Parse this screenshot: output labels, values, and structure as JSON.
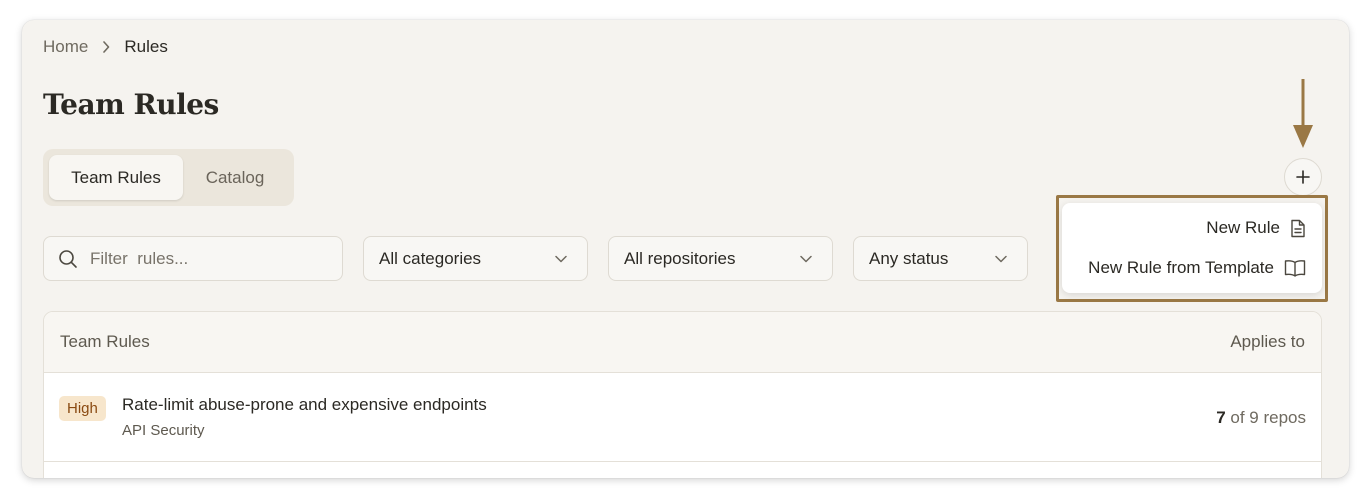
{
  "breadcrumb": {
    "home": "Home",
    "current": "Rules"
  },
  "page": {
    "title": "Team Rules"
  },
  "tabs": [
    {
      "label": "Team Rules",
      "active": true
    },
    {
      "label": "Catalog",
      "active": false
    }
  ],
  "filters": {
    "search_placeholder": "Filter  rules...",
    "category": "All categories",
    "repository": "All repositories",
    "status": "Any status"
  },
  "add_menu": {
    "items": [
      {
        "label": "New Rule",
        "icon": "document-icon"
      },
      {
        "label": "New Rule from Template",
        "icon": "book-icon"
      }
    ]
  },
  "table": {
    "header_left": "Team Rules",
    "header_right": "Applies to",
    "rows": [
      {
        "severity": "High",
        "title": "Rate-limit abuse-prone and expensive endpoints",
        "category": "API Security",
        "applies_count": "7",
        "applies_rest": " of 9 repos"
      }
    ]
  },
  "colors": {
    "accent": "#9a7845",
    "background": "#f5f3ef",
    "badge_bg": "#f7e6cc",
    "badge_text": "#8a4a12"
  }
}
